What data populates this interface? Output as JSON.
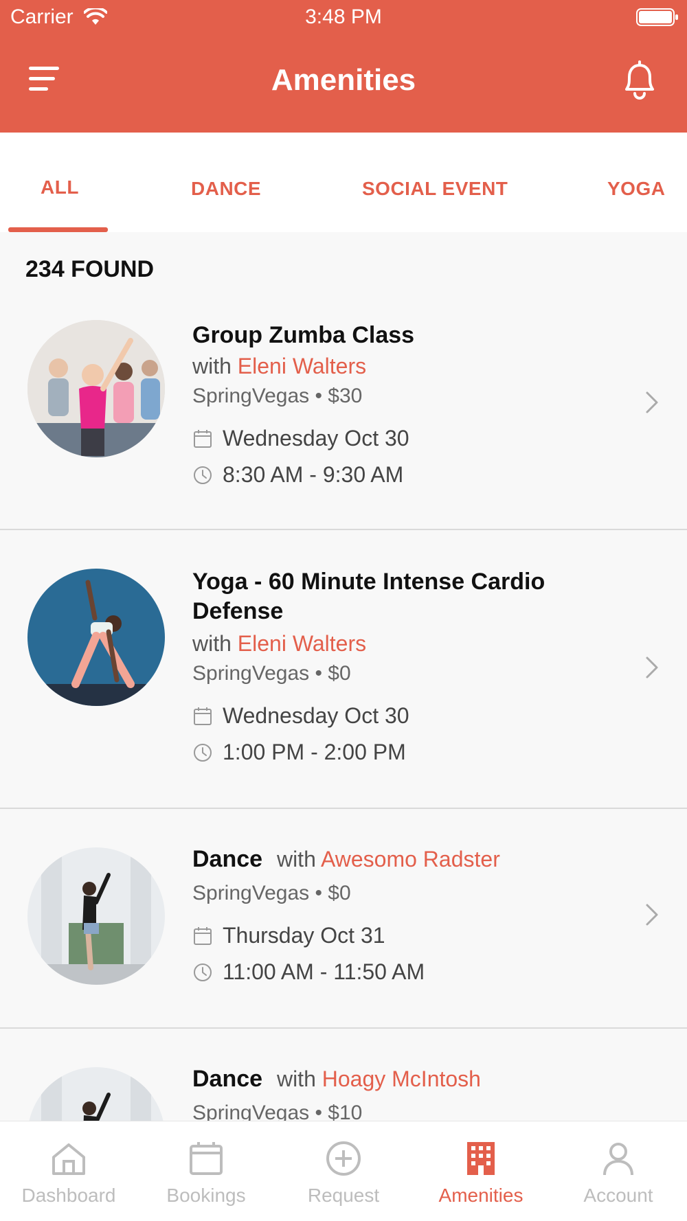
{
  "status_bar": {
    "carrier": "Carrier",
    "time": "3:48 PM"
  },
  "header": {
    "title": "Amenities"
  },
  "tabs": [
    {
      "label": "ALL"
    },
    {
      "label": "DANCE"
    },
    {
      "label": "SOCIAL EVENT"
    },
    {
      "label": "YOGA"
    }
  ],
  "results": {
    "count_label": "234 FOUND"
  },
  "items": [
    {
      "title": "Group Zumba Class",
      "with": "with",
      "instructor": "Eleni Walters",
      "meta": "SpringVegas • $30",
      "date": "Wednesday Oct 30",
      "time": "8:30 AM - 9:30 AM"
    },
    {
      "title": "Yoga - 60 Minute Intense Cardio Defense",
      "with": "with",
      "instructor": "Eleni Walters",
      "meta": "SpringVegas • $0",
      "date": "Wednesday Oct 30",
      "time": "1:00 PM - 2:00 PM"
    },
    {
      "title": "Dance",
      "with": "with",
      "instructor": "Awesomo Radster",
      "meta": "SpringVegas • $0",
      "date": "Thursday Oct 31",
      "time": "11:00 AM - 11:50 AM"
    },
    {
      "title": "Dance",
      "with": "with",
      "instructor": "Hoagy McIntosh",
      "meta": "SpringVegas • $10"
    }
  ],
  "tab_bar": [
    {
      "label": "Dashboard",
      "icon": "home-icon"
    },
    {
      "label": "Bookings",
      "icon": "calendar-icon"
    },
    {
      "label": "Request",
      "icon": "plus-circle-icon"
    },
    {
      "label": "Amenities",
      "icon": "building-icon"
    },
    {
      "label": "Account",
      "icon": "person-icon"
    }
  ],
  "colors": {
    "accent": "#e35f4b",
    "inactive": "#bdbdbd",
    "background": "#f8f8f8"
  }
}
